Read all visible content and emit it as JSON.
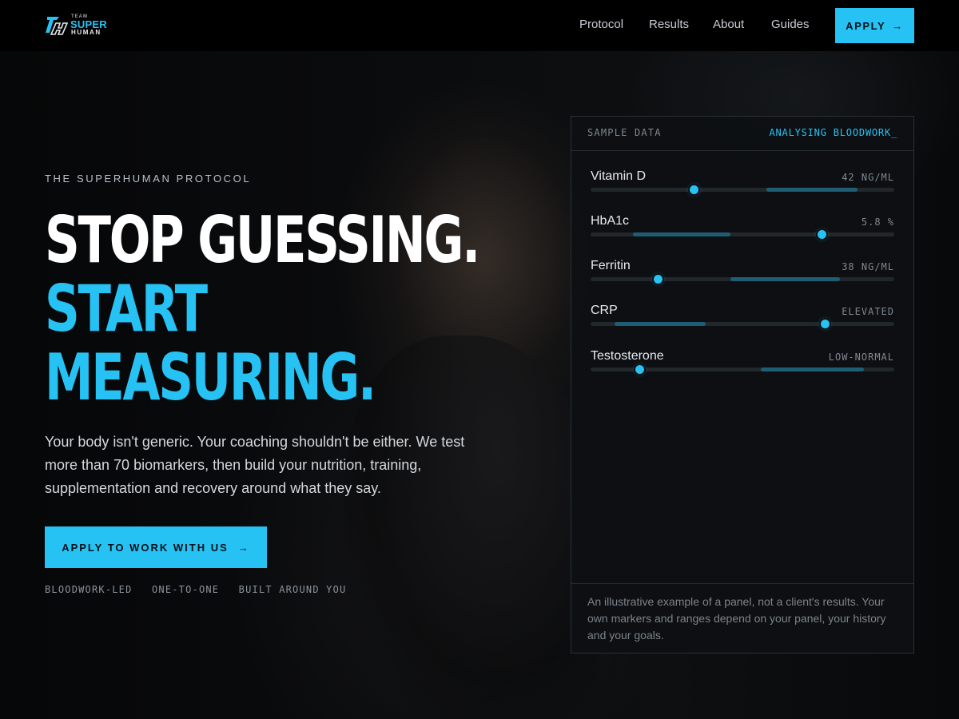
{
  "brand": {
    "logo_small": "TEAM",
    "logo_top": "SUPER",
    "logo_bottom": "HUMAN",
    "accent_color": "#27c2f4"
  },
  "nav": {
    "items": [
      {
        "label": "Protocol"
      },
      {
        "label": "Results"
      },
      {
        "label": "About"
      },
      {
        "label": "Guides"
      }
    ],
    "apply_label": "APPLY",
    "apply_icon": "arrow-right-icon"
  },
  "hero": {
    "eyebrow": "THE SUPERHUMAN PROTOCOL",
    "headline_line1": "STOP GUESSING.",
    "headline_line2": "START",
    "headline_line3": "MEASURING.",
    "body": "Your body isn't generic. Your coaching shouldn't be either. We test more than 70 biomarkers, then build your nutrition, training, supplementation and recovery around what they say.",
    "cta_label": "APPLY TO WORK WITH US",
    "cta_icon": "arrow-right-icon",
    "tags": [
      "BLOODWORK-LED",
      "ONE-TO-ONE",
      "BUILT AROUND YOU"
    ]
  },
  "panel": {
    "header_left": "SAMPLE DATA",
    "header_right": "ANALYSING BLOODWORK_",
    "markers": [
      {
        "name": "Vitamin D",
        "value": "42 NG/ML",
        "range_start": 0.58,
        "range_end": 0.88,
        "marker_pos": 0.34
      },
      {
        "name": "HbA1c",
        "value": "5.8 %",
        "range_start": 0.14,
        "range_end": 0.46,
        "marker_pos": 0.76
      },
      {
        "name": "Ferritin",
        "value": "38 NG/ML",
        "range_start": 0.46,
        "range_end": 0.82,
        "marker_pos": 0.22
      },
      {
        "name": "CRP",
        "value": "ELEVATED",
        "range_start": 0.08,
        "range_end": 0.38,
        "marker_pos": 0.77
      },
      {
        "name": "Testosterone",
        "value": "LOW-NORMAL",
        "range_start": 0.56,
        "range_end": 0.9,
        "marker_pos": 0.16
      }
    ],
    "footer": "An illustrative example of a panel, not a client's results. Your own markers and ranges depend on your panel, your history and your goals."
  }
}
